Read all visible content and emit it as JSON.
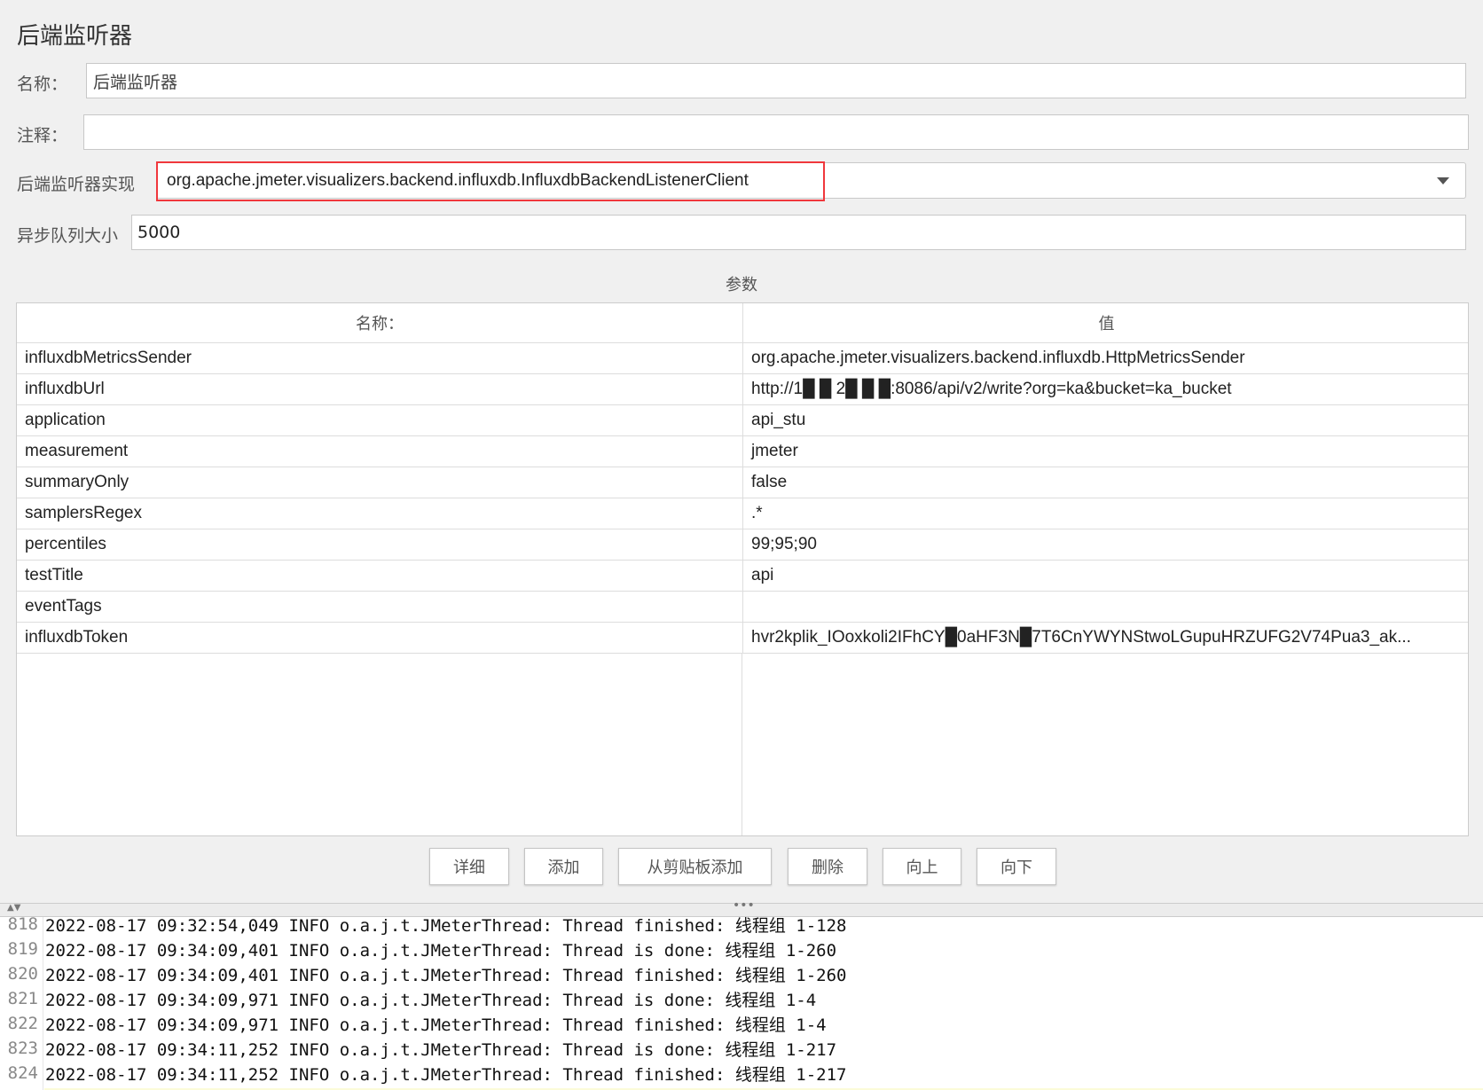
{
  "title": "后端监听器",
  "name": {
    "label": "名称：",
    "value": "后端监听器"
  },
  "comment": {
    "label": "注释：",
    "value": ""
  },
  "impl": {
    "label": "后端监听器实现",
    "value": "org.apache.jmeter.visualizers.backend.influxdb.InfluxdbBackendListenerClient",
    "icon": "chevron-down-icon"
  },
  "queue": {
    "label": "异步队列大小",
    "value": "5000"
  },
  "params": {
    "title": "参数",
    "headers": [
      "名称：",
      "值"
    ],
    "rows": [
      [
        "influxdbMetricsSender",
        "org.apache.jmeter.visualizers.backend.influxdb.HttpMetricsSender"
      ],
      [
        "influxdbUrl",
        "http://1█ █ 2█ █ █:8086/api/v2/write?org=ka&bucket=ka_bucket"
      ],
      [
        "application",
        "api_stu"
      ],
      [
        "measurement",
        "jmeter"
      ],
      [
        "summaryOnly",
        "false"
      ],
      [
        "samplersRegex",
        ".*"
      ],
      [
        "percentiles",
        "99;95;90"
      ],
      [
        "testTitle",
        "api"
      ],
      [
        "eventTags",
        ""
      ],
      [
        "influxdbToken",
        "hvr2kplik_IOoxkoli2IFhCY█0aHF3N█7T6CnYWYNStwoLGupuHRZUFG2V74Pua3_ak..."
      ]
    ]
  },
  "buttons": [
    "详细",
    "添加",
    "从剪贴板添加",
    "删除",
    "向上",
    "向下"
  ],
  "log": [
    [
      "818",
      "2022-08-17 09:32:54,049 INFO o.a.j.t.JMeterThread: Thread finished: 线程组 1-128"
    ],
    [
      "819",
      "2022-08-17 09:34:09,401 INFO o.a.j.t.JMeterThread: Thread is done: 线程组 1-260"
    ],
    [
      "820",
      "2022-08-17 09:34:09,401 INFO o.a.j.t.JMeterThread: Thread finished: 线程组 1-260"
    ],
    [
      "821",
      "2022-08-17 09:34:09,971 INFO o.a.j.t.JMeterThread: Thread is done: 线程组 1-4"
    ],
    [
      "822",
      "2022-08-17 09:34:09,971 INFO o.a.j.t.JMeterThread: Thread finished: 线程组 1-4"
    ],
    [
      "823",
      "2022-08-17 09:34:11,252 INFO o.a.j.t.JMeterThread: Thread is done: 线程组 1-217"
    ],
    [
      "824",
      "2022-08-17 09:34:11,252 INFO o.a.j.t.JMeterThread: Thread finished: 线程组 1-217"
    ]
  ]
}
